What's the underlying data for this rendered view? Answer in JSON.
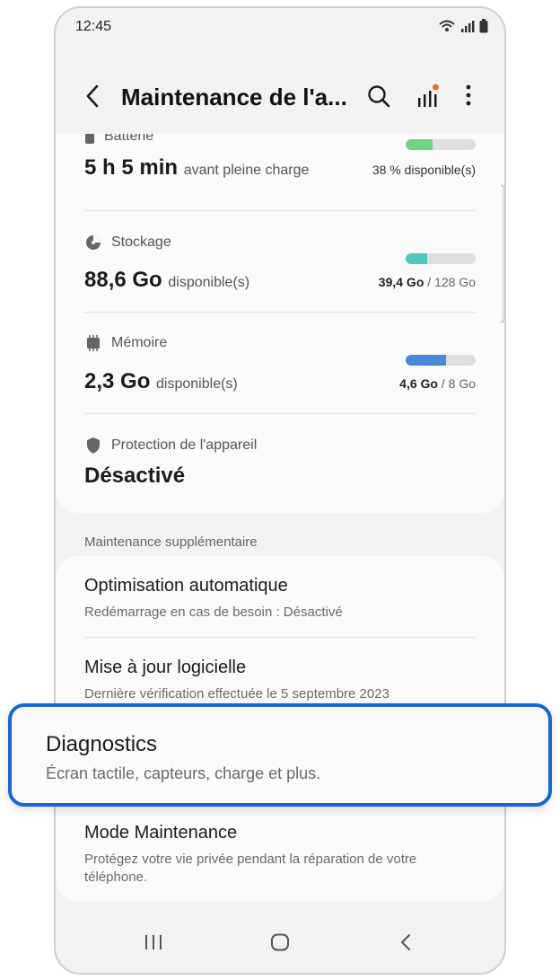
{
  "status_bar": {
    "time": "12:45"
  },
  "app_bar": {
    "title": "Maintenance de l'a..."
  },
  "stats": [
    {
      "label": "Batterie",
      "value": "5 h 5 min",
      "unit": "avant pleine charge",
      "detail": "38 % disponible(s)",
      "fill": 0.38,
      "color": "#6fd47f"
    },
    {
      "label": "Stockage",
      "value": "88,6 Go",
      "unit": "disponible(s)",
      "used": "39,4 Go",
      "total": "128 Go",
      "fill": 0.31,
      "color": "#4cc8c0"
    },
    {
      "label": "Mémoire",
      "value": "2,3 Go",
      "unit": "disponible(s)",
      "used": "4,6 Go",
      "total": "8 Go",
      "fill": 0.575,
      "color": "#4a86d9"
    },
    {
      "label": "Protection de l'appareil",
      "value": "Désactivé"
    }
  ],
  "section_label": "Maintenance supplémentaire",
  "more_items": [
    {
      "title": "Optimisation automatique",
      "subtitle": "Redémarrage en cas de besoin : Désactivé"
    },
    {
      "title": "Mise à jour logicielle",
      "subtitle": "Dernière vérification effectuée le 5 septembre 2023"
    },
    {
      "title": "Mode Maintenance",
      "subtitle": "Protégez votre vie privée pendant la réparation de votre téléphone."
    }
  ],
  "highlight": {
    "title": "Diagnostics",
    "subtitle": "Écran tactile, capteurs, charge et plus."
  },
  "colors": {
    "accent": "#1a66d8",
    "badge": "#f26a1b"
  }
}
